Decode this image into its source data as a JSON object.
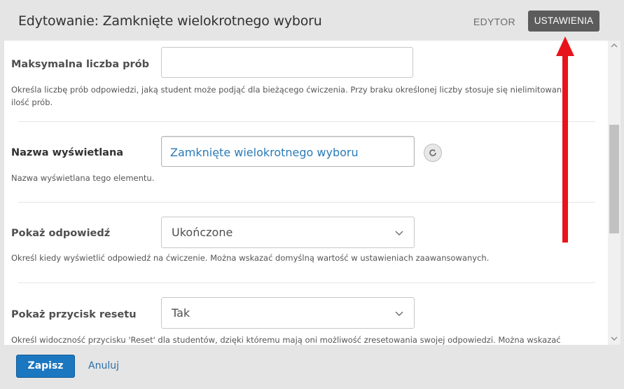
{
  "header": {
    "title": "Edytowanie: Zamknięte wielokrotnego wyboru",
    "tabs": [
      {
        "label": "EDYTOR",
        "active": false
      },
      {
        "label": "USTAWIENIA",
        "active": true
      }
    ]
  },
  "fields": [
    {
      "label": "Maksymalna liczba prób",
      "value": "",
      "help": "Określa liczbę prób odpowiedzi, jaką student może podjąć dla bieżącego ćwiczenia. Przy braku określonej liczby stosuje się nielimitowaną ilość prób."
    },
    {
      "label": "Nazwa wyświetlana",
      "value": "Zamknięte wielokrotnego wyboru",
      "help": "Nazwa wyświetlana tego elementu."
    },
    {
      "label": "Pokaż odpowiedź",
      "value": "Ukończone",
      "help": "Określ kiedy wyświetlić odpowiedź na ćwiczenie. Można wskazać domyślną wartość w ustawieniach zaawansowanych."
    },
    {
      "label": "Pokaż przycisk resetu",
      "value": "Tak",
      "help": "Określ widoczność przycisku 'Reset' dla studentów, dzięki któremu mają oni możliwość zresetowania swojej odpowiedzi. Można wskazać"
    }
  ],
  "footer": {
    "save_label": "Zapisz",
    "cancel_label": "Anuluj"
  },
  "icons": {
    "reset": "reset-icon",
    "chevron": "chevron-down-icon",
    "annotation": "red-arrow-annotation"
  },
  "colors": {
    "primary": "#1b77c0",
    "active_tab": "#5c5c5c",
    "annotation_arrow": "#e8141b",
    "input_text": "#2a7bb8"
  }
}
